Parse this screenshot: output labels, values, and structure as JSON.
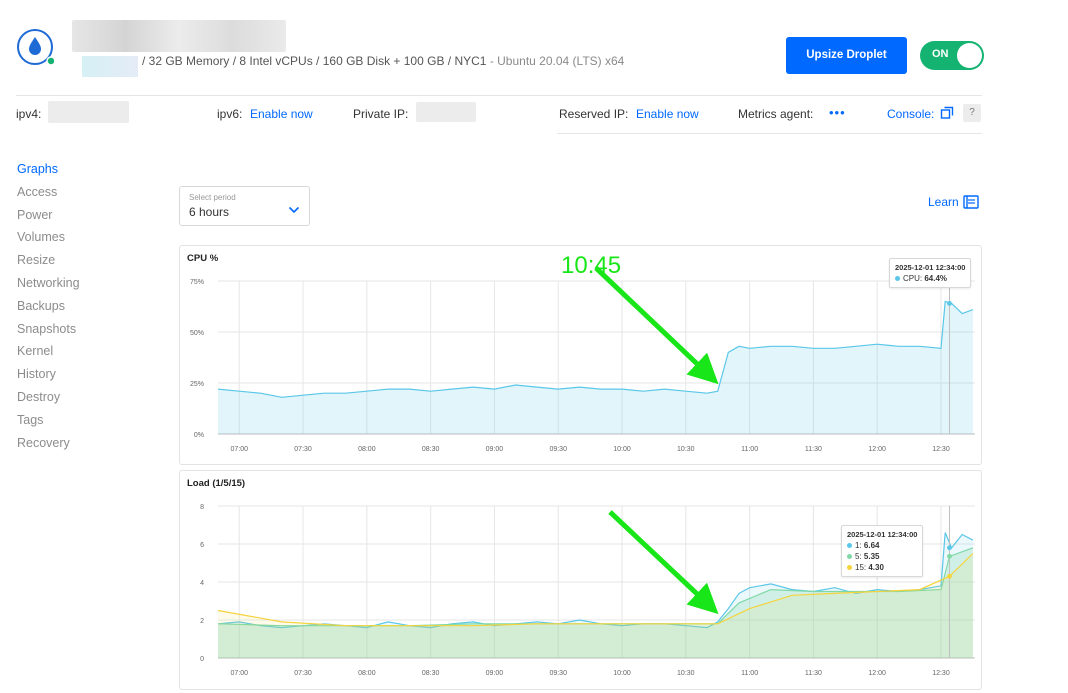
{
  "header": {
    "specs": "/ 32 GB Memory / 8 Intel vCPUs / 160 GB Disk + 100 GB / NYC1",
    "os": "- Ubuntu 20.04 (LTS) x64",
    "upsize_label": "Upsize Droplet",
    "power_label": "ON"
  },
  "infobar": {
    "ipv4_label": "ipv4:",
    "ipv6_label": "ipv6:",
    "ipv6_action": "Enable now",
    "private_ip_label": "Private IP:",
    "reserved_ip_label": "Reserved IP:",
    "reserved_ip_action": "Enable now",
    "metrics_label": "Metrics agent:",
    "metrics_value": "•••",
    "console_label": "Console:",
    "help_label": "?"
  },
  "sidebar": {
    "items": [
      {
        "label": "Graphs"
      },
      {
        "label": "Access"
      },
      {
        "label": "Power"
      },
      {
        "label": "Volumes"
      },
      {
        "label": "Resize"
      },
      {
        "label": "Networking"
      },
      {
        "label": "Backups"
      },
      {
        "label": "Snapshots"
      },
      {
        "label": "Kernel"
      },
      {
        "label": "History"
      },
      {
        "label": "Destroy"
      },
      {
        "label": "Tags"
      },
      {
        "label": "Recovery"
      }
    ]
  },
  "period": {
    "caption": "Select period",
    "value": "6 hours"
  },
  "learn_label": "Learn",
  "annotation": {
    "text": "10:45"
  },
  "colors": {
    "accent": "#0069ff",
    "toggle": "#15b371",
    "cpu": "#5bc7e8",
    "load1": "#5bc7e8",
    "load5": "#7fd9a6",
    "load15": "#f5d33b",
    "arrow": "#19e619"
  },
  "chart_data": [
    {
      "type": "area",
      "title": "CPU %",
      "x_ticks": [
        "07:00",
        "07:30",
        "08:00",
        "08:30",
        "09:00",
        "09:30",
        "10:00",
        "10:30",
        "11:00",
        "11:30",
        "12:00",
        "12:30"
      ],
      "y_ticks": [
        "0%",
        "25%",
        "50%",
        "75%"
      ],
      "ylim": [
        0,
        75
      ],
      "series": [
        {
          "name": "CPU",
          "points": [
            [
              "06:50",
              22
            ],
            [
              "07:00",
              21
            ],
            [
              "07:10",
              20
            ],
            [
              "07:20",
              18
            ],
            [
              "07:30",
              19
            ],
            [
              "07:40",
              20
            ],
            [
              "07:50",
              20
            ],
            [
              "08:00",
              21
            ],
            [
              "08:10",
              22
            ],
            [
              "08:20",
              22
            ],
            [
              "08:30",
              21
            ],
            [
              "08:40",
              22
            ],
            [
              "08:50",
              23
            ],
            [
              "09:00",
              22
            ],
            [
              "09:10",
              24
            ],
            [
              "09:20",
              23
            ],
            [
              "09:30",
              22
            ],
            [
              "09:40",
              23
            ],
            [
              "09:50",
              22
            ],
            [
              "10:00",
              22
            ],
            [
              "10:10",
              21
            ],
            [
              "10:20",
              22
            ],
            [
              "10:30",
              21
            ],
            [
              "10:40",
              20
            ],
            [
              "10:45",
              21
            ],
            [
              "10:50",
              40
            ],
            [
              "10:55",
              43
            ],
            [
              "11:00",
              42
            ],
            [
              "11:10",
              43
            ],
            [
              "11:20",
              43
            ],
            [
              "11:30",
              42
            ],
            [
              "11:40",
              42
            ],
            [
              "11:50",
              43
            ],
            [
              "12:00",
              44
            ],
            [
              "12:10",
              43
            ],
            [
              "12:20",
              43
            ],
            [
              "12:30",
              42
            ],
            [
              "12:32",
              65
            ],
            [
              "12:35",
              64
            ],
            [
              "12:40",
              59
            ],
            [
              "12:45",
              61
            ]
          ]
        }
      ],
      "tooltip": {
        "time": "2025-12-01 12:34:00",
        "label": "CPU:",
        "value": "64.4%"
      }
    },
    {
      "type": "area",
      "title": "Load (1/5/15)",
      "x_ticks": [
        "07:00",
        "07:30",
        "08:00",
        "08:30",
        "09:00",
        "09:30",
        "10:00",
        "10:30",
        "11:00",
        "11:30",
        "12:00",
        "12:30"
      ],
      "y_ticks": [
        "0",
        "2",
        "4",
        "6",
        "8"
      ],
      "ylim": [
        0,
        8
      ],
      "series": [
        {
          "name": "1",
          "points": [
            [
              "06:50",
              1.8
            ],
            [
              "07:00",
              1.9
            ],
            [
              "07:10",
              1.7
            ],
            [
              "07:20",
              1.6
            ],
            [
              "07:30",
              1.7
            ],
            [
              "07:40",
              1.8
            ],
            [
              "07:50",
              1.7
            ],
            [
              "08:00",
              1.6
            ],
            [
              "08:10",
              1.9
            ],
            [
              "08:20",
              1.7
            ],
            [
              "08:30",
              1.6
            ],
            [
              "08:40",
              1.8
            ],
            [
              "08:50",
              1.9
            ],
            [
              "09:00",
              1.7
            ],
            [
              "09:10",
              1.8
            ],
            [
              "09:20",
              1.9
            ],
            [
              "09:30",
              1.8
            ],
            [
              "09:40",
              2.0
            ],
            [
              "09:50",
              1.8
            ],
            [
              "10:00",
              1.7
            ],
            [
              "10:10",
              1.8
            ],
            [
              "10:20",
              1.8
            ],
            [
              "10:30",
              1.7
            ],
            [
              "10:40",
              1.6
            ],
            [
              "10:45",
              1.9
            ],
            [
              "10:50",
              2.6
            ],
            [
              "10:55",
              3.4
            ],
            [
              "11:00",
              3.7
            ],
            [
              "11:10",
              3.9
            ],
            [
              "11:20",
              3.6
            ],
            [
              "11:30",
              3.5
            ],
            [
              "11:40",
              3.7
            ],
            [
              "11:50",
              3.4
            ],
            [
              "12:00",
              3.6
            ],
            [
              "12:10",
              3.5
            ],
            [
              "12:20",
              3.6
            ],
            [
              "12:30",
              3.8
            ],
            [
              "12:32",
              6.6
            ],
            [
              "12:35",
              5.8
            ],
            [
              "12:40",
              6.5
            ],
            [
              "12:45",
              6.2
            ]
          ]
        },
        {
          "name": "5",
          "points": [
            [
              "06:50",
              1.8
            ],
            [
              "07:20",
              1.7
            ],
            [
              "07:50",
              1.7
            ],
            [
              "08:20",
              1.7
            ],
            [
              "08:50",
              1.8
            ],
            [
              "09:20",
              1.8
            ],
            [
              "09:50",
              1.8
            ],
            [
              "10:20",
              1.8
            ],
            [
              "10:45",
              1.8
            ],
            [
              "10:55",
              2.9
            ],
            [
              "11:10",
              3.6
            ],
            [
              "11:30",
              3.5
            ],
            [
              "11:50",
              3.5
            ],
            [
              "12:10",
              3.5
            ],
            [
              "12:30",
              3.6
            ],
            [
              "12:34",
              5.35
            ],
            [
              "12:45",
              5.8
            ]
          ]
        },
        {
          "name": "15",
          "points": [
            [
              "06:50",
              2.5
            ],
            [
              "07:20",
              1.9
            ],
            [
              "07:50",
              1.7
            ],
            [
              "08:20",
              1.7
            ],
            [
              "08:50",
              1.7
            ],
            [
              "09:20",
              1.8
            ],
            [
              "09:50",
              1.8
            ],
            [
              "10:20",
              1.8
            ],
            [
              "10:45",
              1.8
            ],
            [
              "11:00",
              2.6
            ],
            [
              "11:20",
              3.3
            ],
            [
              "11:40",
              3.4
            ],
            [
              "12:00",
              3.5
            ],
            [
              "12:20",
              3.6
            ],
            [
              "12:34",
              4.3
            ],
            [
              "12:45",
              5.5
            ]
          ]
        }
      ],
      "tooltip": {
        "time": "2025-12-01 12:34:00",
        "rows": [
          {
            "label": "1:",
            "value": "6.64"
          },
          {
            "label": "5:",
            "value": "5.35"
          },
          {
            "label": "15:",
            "value": "4.30"
          }
        ]
      }
    }
  ]
}
